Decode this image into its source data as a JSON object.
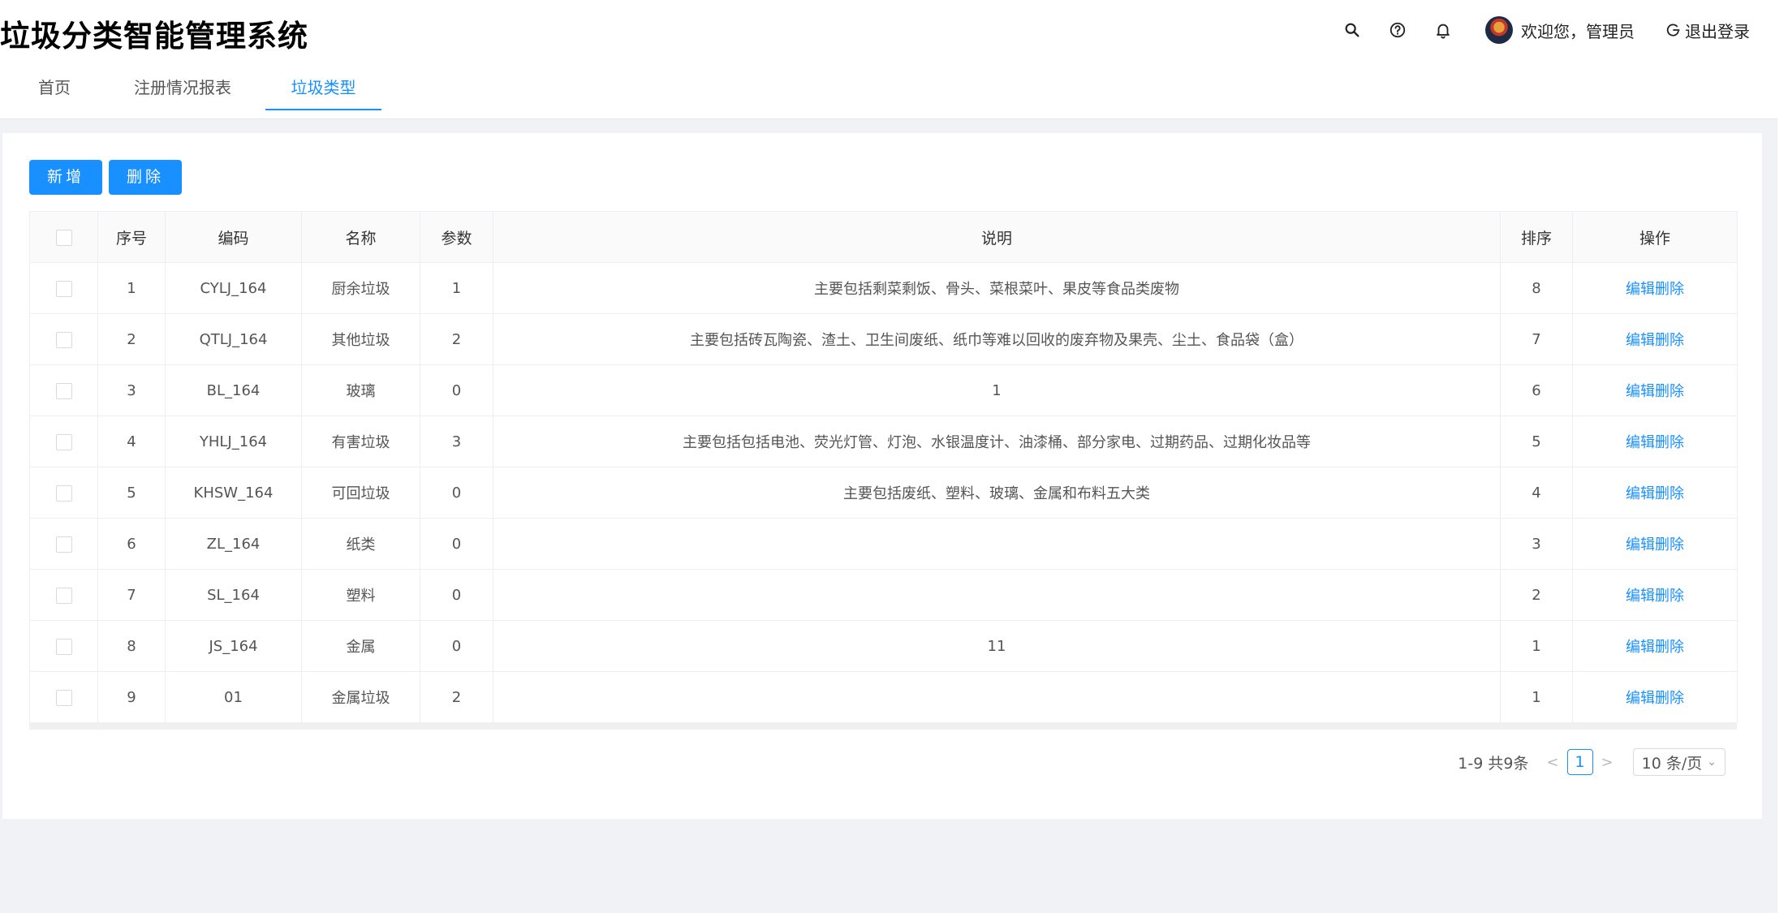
{
  "app_title": "垃圾分类智能管理系统",
  "header": {
    "icons": [
      "search-icon",
      "help-icon",
      "bell-icon"
    ],
    "welcome": "欢迎您，管理员",
    "logout": "退出登录"
  },
  "tabs": [
    {
      "label": "首页",
      "active": false
    },
    {
      "label": "注册情况报表",
      "active": false
    },
    {
      "label": "垃圾类型",
      "active": true
    }
  ],
  "toolbar": {
    "add_label": "新增",
    "delete_label": "删除"
  },
  "table": {
    "columns": [
      "序号",
      "编码",
      "名称",
      "参数",
      "说明",
      "排序",
      "操作"
    ],
    "rows": [
      {
        "index": "1",
        "code": "CYLJ_164",
        "name": "厨余垃圾",
        "param": "1",
        "desc": "主要包括剩菜剩饭、骨头、菜根菜叶、果皮等食品类废物",
        "sort": "8",
        "op": "编辑删除"
      },
      {
        "index": "2",
        "code": "QTLJ_164",
        "name": "其他垃圾",
        "param": "2",
        "desc": "主要包括砖瓦陶瓷、渣土、卫生间废纸、纸巾等难以回收的废弃物及果壳、尘土、食品袋（盒）",
        "sort": "7",
        "op": "编辑删除"
      },
      {
        "index": "3",
        "code": "BL_164",
        "name": "玻璃",
        "param": "0",
        "desc": "1",
        "sort": "6",
        "op": "编辑删除"
      },
      {
        "index": "4",
        "code": "YHLJ_164",
        "name": "有害垃圾",
        "param": "3",
        "desc": "主要包括包括电池、荧光灯管、灯泡、水银温度计、油漆桶、部分家电、过期药品、过期化妆品等",
        "sort": "5",
        "op": "编辑删除"
      },
      {
        "index": "5",
        "code": "KHSW_164",
        "name": "可回垃圾",
        "param": "0",
        "desc": "主要包括废纸、塑料、玻璃、金属和布料五大类",
        "sort": "4",
        "op": "编辑删除"
      },
      {
        "index": "6",
        "code": "ZL_164",
        "name": "纸类",
        "param": "0",
        "desc": "",
        "sort": "3",
        "op": "编辑删除"
      },
      {
        "index": "7",
        "code": "SL_164",
        "name": "塑料",
        "param": "0",
        "desc": "",
        "sort": "2",
        "op": "编辑删除"
      },
      {
        "index": "8",
        "code": "JS_164",
        "name": "金属",
        "param": "0",
        "desc": "11",
        "sort": "1",
        "op": "编辑删除"
      },
      {
        "index": "9",
        "code": "01",
        "name": "金属垃圾",
        "param": "2",
        "desc": "",
        "sort": "1",
        "op": "编辑删除"
      }
    ]
  },
  "pagination": {
    "summary": "1-9 共9条",
    "prev": "<",
    "current": "1",
    "next": ">",
    "page_size": "10 条/页"
  },
  "colors": {
    "primary": "#1890ff",
    "page_bg": "#f0f2f5"
  }
}
